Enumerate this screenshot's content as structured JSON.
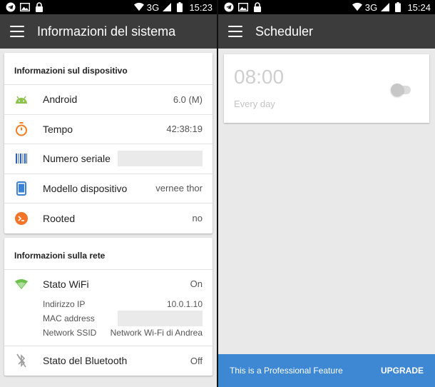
{
  "left": {
    "status": {
      "network": "3G",
      "time": "15:23"
    },
    "toolbar": {
      "title": "Informazioni del sistema"
    },
    "device_card": {
      "title": "Informazioni sul dispositivo",
      "rows": [
        {
          "label": "Android",
          "value": "6.0 (M)",
          "icon": "android-icon"
        },
        {
          "label": "Tempo",
          "value": "42:38:19",
          "icon": "stopwatch-icon"
        },
        {
          "label": "Numero seriale",
          "value": "",
          "icon": "barcode-icon"
        },
        {
          "label": "Modello dispositivo",
          "value": "vernee thor",
          "icon": "phone-icon"
        },
        {
          "label": "Rooted",
          "value": "no",
          "icon": "terminal-icon"
        }
      ]
    },
    "network_card": {
      "title": "Informazioni sulla rete",
      "wifi": {
        "label": "Stato WiFi",
        "value": "On",
        "ip_label": "Indirizzo IP",
        "ip_value": "10.0.1.10",
        "mac_label": "MAC address",
        "ssid_label": "Network SSID",
        "ssid_value": "Network Wi-Fi di Andrea"
      },
      "bluetooth": {
        "label": "Stato del Bluetooth",
        "value": "Off"
      }
    }
  },
  "right": {
    "status": {
      "network": "3G",
      "time": "15:24"
    },
    "toolbar": {
      "title": "Scheduler"
    },
    "schedule": {
      "time": "08:00",
      "repeat": "Every day",
      "enabled": false
    },
    "upgrade": {
      "text": "This is a Professional Feature",
      "button": "UPGRADE"
    }
  },
  "colors": {
    "toolbar": "#3c3c3c",
    "android_green": "#8bc34a",
    "stopwatch_orange": "#f57c1f",
    "barcode_blue": "#2f5fb3",
    "phone_blue": "#3b82d6",
    "terminal_orange": "#f4742a",
    "wifi_green": "#6cc14b",
    "upgrade_blue": "#3d87d3"
  }
}
